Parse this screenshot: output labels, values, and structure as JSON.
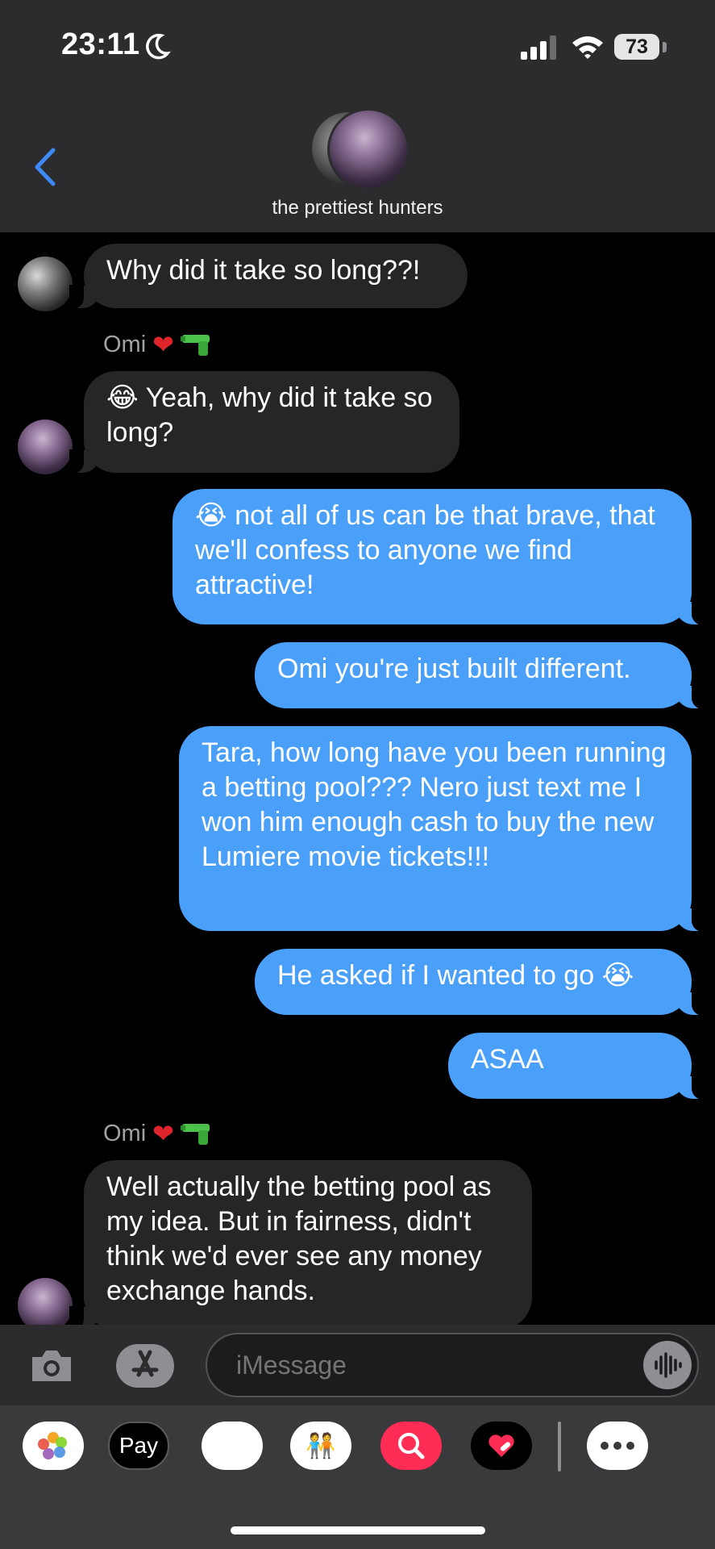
{
  "status": {
    "time": "23:11",
    "battery": "73"
  },
  "header": {
    "group_name": "the prettiest hunters"
  },
  "messages": [
    {
      "text": "Why did it take so long??!"
    },
    {
      "sender": "Omi",
      "text_emoji": "😂",
      "text": "Yeah, why did it take so long?"
    },
    {
      "text_emoji": "😭",
      "text": "not all of us can be that brave, that we'll confess to anyone we find attractive!"
    },
    {
      "text": "Omi you're just built different."
    },
    {
      "text": "Tara, how long have you been running a betting pool??? Nero just text me I won him enough cash to buy the new Lumiere movie tickets!!!"
    },
    {
      "text": "He asked if I wanted to go",
      "text_emoji": "😭"
    },
    {
      "text": "ASAA"
    },
    {
      "sender": "Omi",
      "text": "Well actually the betting pool as my idea. But in fairness, didn't think we'd ever see any money exchange hands."
    }
  ],
  "composer": {
    "placeholder": "iMessage"
  },
  "drawer": {
    "apple_pay_label": "Pay"
  },
  "icons": {
    "back": "chevron-left-icon",
    "camera": "camera-icon",
    "appstore": "app-store-icon",
    "audio": "waveform-icon",
    "more": "ellipsis-icon"
  },
  "colors": {
    "outgoing": "#4aa0f8",
    "incoming": "#262628",
    "header": "#2c2c2e",
    "accent": "#3d8af7"
  }
}
